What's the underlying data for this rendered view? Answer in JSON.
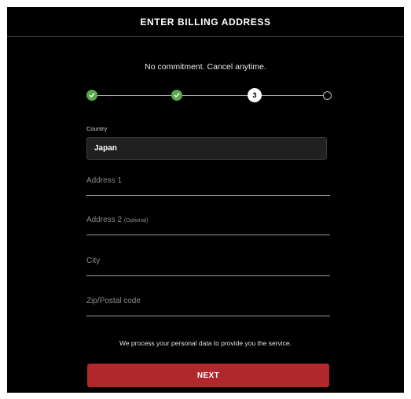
{
  "header": {
    "title": "ENTER BILLING ADDRESS"
  },
  "subtitle": "No commitment. Cancel anytime.",
  "stepper": {
    "current_step_label": "3",
    "steps": [
      {
        "state": "completed",
        "icon": "check-icon"
      },
      {
        "state": "completed",
        "icon": "check-icon"
      },
      {
        "state": "current"
      },
      {
        "state": "upcoming"
      }
    ]
  },
  "form": {
    "country": {
      "label": "Country",
      "value": "Japan"
    },
    "address1": {
      "placeholder": "Address 1"
    },
    "address2": {
      "placeholder": "Address 2",
      "optional_note": "(Optional)"
    },
    "city": {
      "placeholder": "City"
    },
    "zip": {
      "placeholder": "Zip/Postal code"
    }
  },
  "privacy_note": "We process your personal data to provide you the service.",
  "next_button": {
    "label": "NEXT"
  },
  "colors": {
    "background": "#000000",
    "step_complete": "#5aa84c",
    "button": "#b0282b"
  }
}
